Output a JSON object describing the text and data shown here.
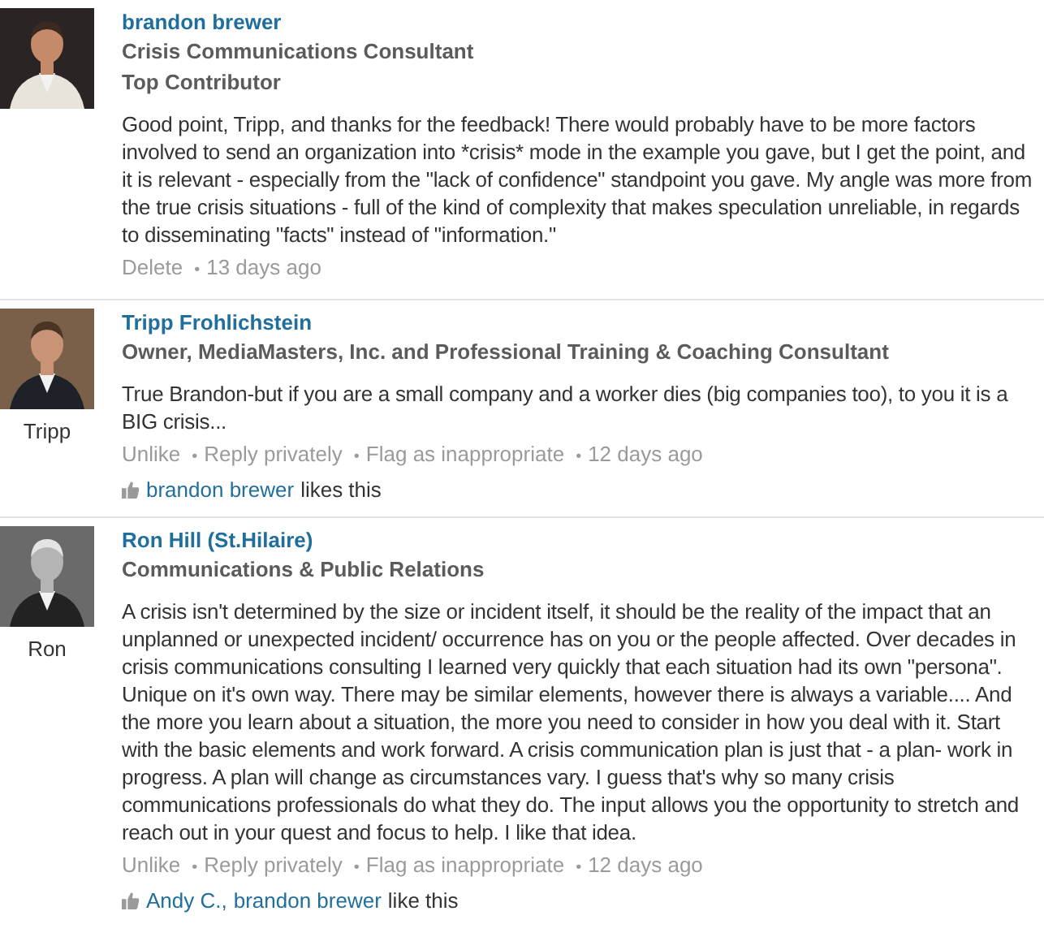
{
  "separator": "•",
  "comments": [
    {
      "author": "brandon brewer",
      "headlines": [
        "Crisis Communications Consultant",
        "Top Contributor"
      ],
      "avatar": {
        "kind": "picture"
      },
      "body": "Good point, Tripp, and thanks for the feedback! There would probably have to be more factors involved to send an organization into *crisis* mode in the example you gave, but I get the point, and it is relevant - especially from the \"lack of confidence\" standpoint you gave. My angle was more from the true crisis situations - full of the kind of complexity that makes speculation unreliable, in regards to disseminating \"facts\" instead of \"information.\"",
      "actions": [
        "Delete"
      ],
      "time": "13 days ago"
    },
    {
      "author": "Tripp Frohlichstein",
      "headlines": [
        "Owner, MediaMasters, Inc. and Professional Training & Coaching Consultant"
      ],
      "avatar": {
        "kind": "picture",
        "caption": "Tripp"
      },
      "body": "True Brandon-but if you are a small company and a worker dies (big companies too), to you it is a BIG crisis...",
      "actions": [
        "Unlike",
        "Reply privately",
        "Flag as inappropriate"
      ],
      "time": "12 days ago",
      "likes": {
        "names": [
          "brandon brewer"
        ],
        "text": "likes this"
      }
    },
    {
      "author": "Ron Hill (St.Hilaire)",
      "headlines": [
        "Communications & Public Relations"
      ],
      "avatar": {
        "kind": "picture",
        "caption": "Ron"
      },
      "body": "A crisis isn't determined by the size or incident itself, it should be the reality of the impact that an unplanned or unexpected incident/ occurrence has on you or the people affected. Over decades in crisis communications consulting I learned very quickly that each situation had its own \"persona\". Unique on it's own way. There may be similar elements, however there is always a variable.... And the more you learn about a situation, the more you need to consider in how you deal with it. Start with the basic elements and work forward. A crisis communication plan is just that - a plan- work in progress. A plan will change as circumstances vary. I guess that's why so many crisis communications professionals do what they do. The input allows you the opportunity to stretch and reach out in your quest and focus to help. I like that idea.",
      "actions": [
        "Unlike",
        "Reply privately",
        "Flag as inappropriate"
      ],
      "time": "12 days ago",
      "likes": {
        "names": [
          "Andy C.,",
          "brandon brewer"
        ],
        "text": "like this"
      }
    }
  ]
}
